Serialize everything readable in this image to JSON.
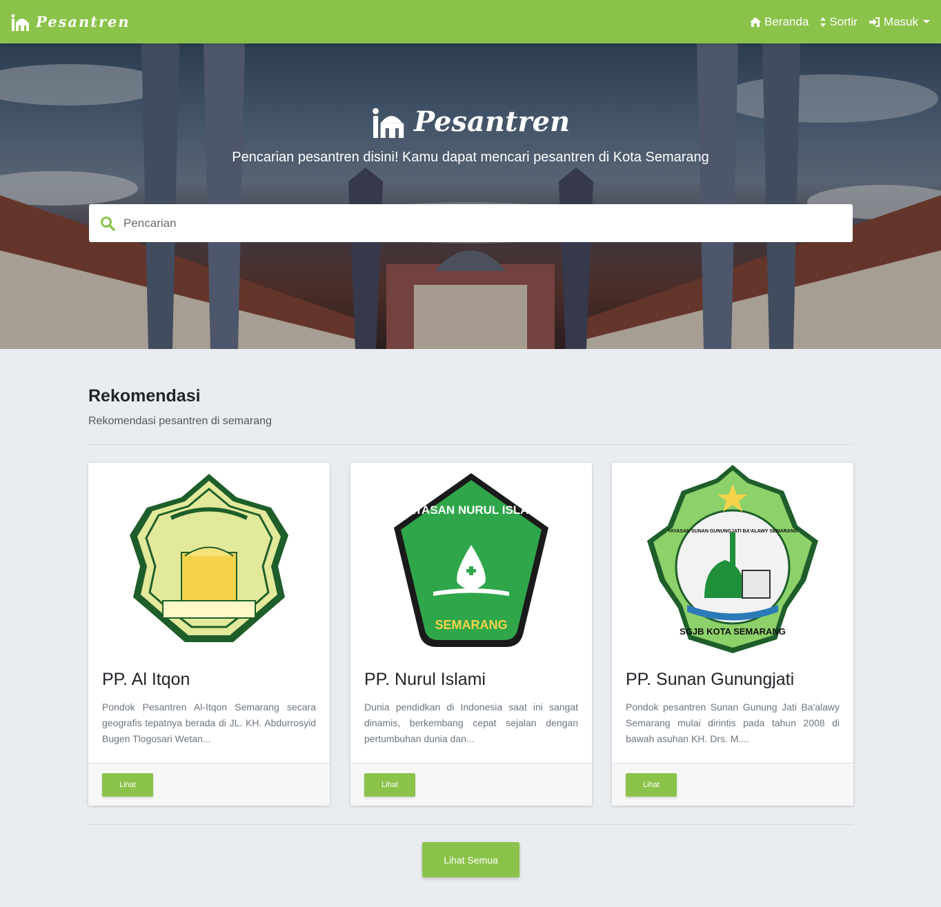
{
  "navbar": {
    "brand": "Pesantren",
    "links": [
      {
        "label": "Beranda",
        "icon": "home-icon"
      },
      {
        "label": "Sortir",
        "icon": "sort-icon"
      },
      {
        "label": "Masuk",
        "icon": "sign-in-icon"
      }
    ]
  },
  "hero": {
    "brand": "Pesantren",
    "subtitle": "Pencarian pesantren disini! Kamu dapat mencari pesantren di Kota Semarang",
    "search_placeholder": "Pencarian"
  },
  "section": {
    "title": "Rekomendasi",
    "subtitle": "Rekomendasi pesantren di semarang"
  },
  "cards": [
    {
      "title": "PP. Al Itqon",
      "text": "Pondok Pesantren Al-Itqon Semarang secara geografis tepatnya berada di JL. KH. Abdurrosyid Bugen Tlogosari Wetan...",
      "button": "Lihat"
    },
    {
      "title": "PP. Nurul Islami",
      "text": "Dunia pendidkan di Indonesia saat ini sangat dinamis, berkembang cepat sejalan dengan pertumbuhan dunia dan...",
      "button": "Lihat",
      "logo_text_top": "YAYASAN NURUL ISLAMI",
      "logo_text_bottom": "SEMARANG"
    },
    {
      "title": "PP. Sunan Gunungjati",
      "text": "Pondok pesantren Sunan Gunung Jati Ba'alawy Semarang mulai dirintis pada tahun 2008 di bawah asuhan KH. Drs. M....",
      "button": "Lihat",
      "logo_text_top": "YAYASAN SUNAN GUNUNGJATI BA'ALAWY SEMARANG",
      "logo_text_bottom": "SGJB KOTA SEMARANG"
    }
  ],
  "footer_button": "Lihat Semua",
  "colors": {
    "primary": "#8bc34a",
    "background": "#e9ecf0"
  }
}
